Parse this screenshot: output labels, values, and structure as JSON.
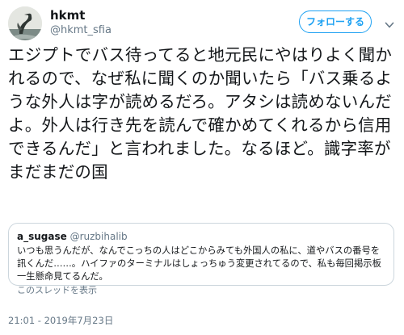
{
  "user": {
    "display_name": "hkmt",
    "screen_name": "@hkmt_sfia",
    "avatar_icon": "heron-avatar-photo"
  },
  "follow_button": {
    "label": "フォローする",
    "color": "#1da1f2"
  },
  "menu": {
    "icon": "chevron-down-icon"
  },
  "tweet": {
    "text": "エジプトでバス待ってると地元民にやはりよく聞かれるので、なぜ私に聞くのか聞いたら「バス乗るような外人は字が読めるだろ。アタシは読めないんだよ。外人は行き先を読んで確かめてくれるから信用できるんだ」と言われました。なるほど。識字率がまだまだの国"
  },
  "quoted_tweet": {
    "name": "a_sugase",
    "handle": "@ruzbihalib",
    "text": "いつも思うんだが、なんでこっちの人はどこからみても外国人の私に、道やバスの番号を訊くんだ……。ハイファのターミナルはしょっちゅう変更されてるので、私も毎回掲示板一生懸命見てるんだ。",
    "thread_link": "このスレッドを表示"
  },
  "timestamp": "21:01 - 2019年7月23日",
  "colors": {
    "text": "#14171a",
    "secondary": "#657786",
    "border": "#ccd6dd",
    "accent": "#1da1f2"
  }
}
